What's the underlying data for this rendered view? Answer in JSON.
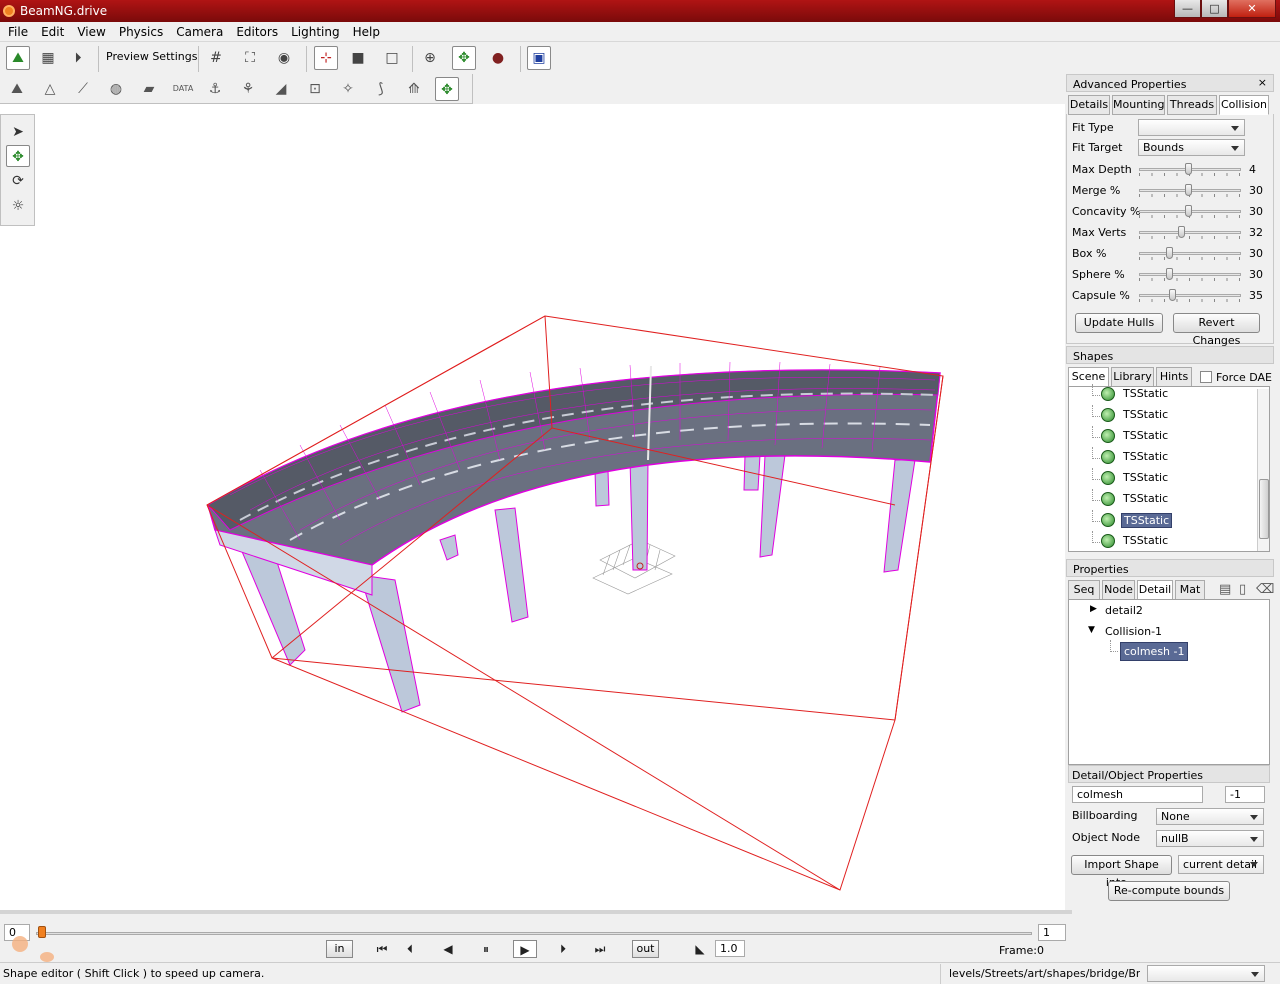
{
  "window": {
    "title": "BeamNG.drive",
    "minimize": "—",
    "maximize": "□",
    "close": "✕"
  },
  "menu": [
    "File",
    "Edit",
    "View",
    "Physics",
    "Camera",
    "Editors",
    "Lighting",
    "Help"
  ],
  "toolbar": {
    "preview_settings": "Preview Settings"
  },
  "advanced": {
    "title": "Advanced Properties",
    "close": "×",
    "tabs": [
      "Details",
      "Mounting",
      "Threads",
      "Collision"
    ],
    "fit_type_label": "Fit Type",
    "fit_type_value": "",
    "fit_target_label": "Fit Target",
    "fit_target_value": "Bounds",
    "sliders": [
      {
        "label": "Max Depth",
        "value": "4",
        "level": 0.48
      },
      {
        "label": "Merge %",
        "value": "30",
        "level": 0.48
      },
      {
        "label": "Concavity %",
        "value": "30",
        "level": 0.48
      },
      {
        "label": "Max Verts",
        "value": "32",
        "level": 0.41
      },
      {
        "label": "Box %",
        "value": "30",
        "level": 0.28
      },
      {
        "label": "Sphere %",
        "value": "30",
        "level": 0.28
      },
      {
        "label": "Capsule %",
        "value": "35",
        "level": 0.32
      }
    ],
    "update_hulls": "Update Hulls",
    "revert_changes": "Revert Changes"
  },
  "shapes": {
    "title": "Shapes",
    "tabs": [
      "Scene",
      "Library",
      "Hints"
    ],
    "force_dae": "Force DAE",
    "items": [
      "TSStatic",
      "TSStatic",
      "TSStatic",
      "TSStatic",
      "TSStatic",
      "TSStatic",
      "TSStatic",
      "TSStatic"
    ],
    "selected_index": 6
  },
  "properties": {
    "title": "Properties",
    "tabs": [
      "Seq",
      "Node",
      "Detail",
      "Mat"
    ],
    "tree": {
      "detail2": "detail2",
      "collision": "Collision-1",
      "colmesh": "colmesh -1"
    },
    "detail_object_title": "Detail/Object Properties",
    "name_value": "colmesh",
    "size_value": "-1",
    "billboarding_label": "Billboarding",
    "billboarding_value": "None",
    "object_node_label": "Object Node",
    "object_node_value": "nullB",
    "import_shape": "Import Shape into...",
    "current_detail": "current detail",
    "recompute_bounds": "Re-compute bounds"
  },
  "timeline": {
    "start": "0",
    "end": "1",
    "in": "in",
    "out": "out",
    "speed": "1.0",
    "frame_label": "Frame:",
    "frame_value": "0"
  },
  "status": {
    "message": "Shape editor ( Shift Click ) to speed up camera.",
    "path": "levels/Streets/art/shapes/bridge/Bridg",
    "dropdown": ""
  }
}
